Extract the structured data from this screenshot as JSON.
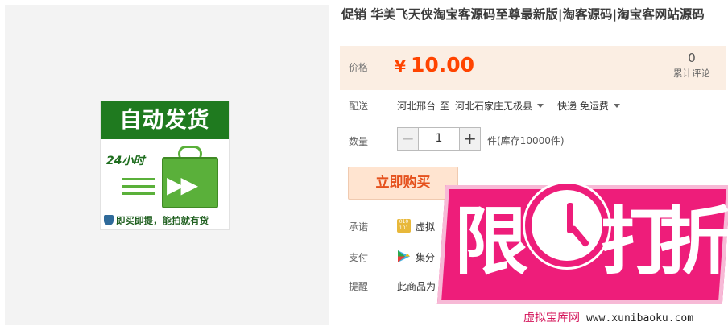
{
  "product_image": {
    "headline": "自动发货",
    "hours": "24小时",
    "footer": "即买即提，能拍就有货"
  },
  "title": "促销 华美飞天侠淘宝客源码至尊最新版|淘客源码|淘宝客网站源码",
  "price": {
    "label": "价格",
    "currency": "¥",
    "value": "10.00"
  },
  "reviews": {
    "count": "0",
    "label": "累计评论"
  },
  "shipping": {
    "label": "配送",
    "from": "河北邢台",
    "to_word": "至",
    "destination": "河北石家庄无极县",
    "method": "快递 免运费"
  },
  "quantity": {
    "label": "数量",
    "value": "1",
    "minus": "−",
    "plus": "+",
    "stock": "件(库存10000件)"
  },
  "buy_button": "立即购买",
  "promise": {
    "label": "承诺",
    "text": "虚拟"
  },
  "payment": {
    "label": "支付",
    "text": "集分"
  },
  "reminder": {
    "label": "提醒",
    "text": "此商品为"
  },
  "badge": {
    "char1": "限",
    "char2": "打",
    "char3": "折"
  },
  "watermark": {
    "site": "虚拟宝库网",
    "url": "www.xunibaoku.com"
  },
  "colors": {
    "accent": "#ff4400",
    "price_bg": "#fbeee3",
    "badge": "#ee1d7a",
    "image_green": "#1f7a1f"
  }
}
